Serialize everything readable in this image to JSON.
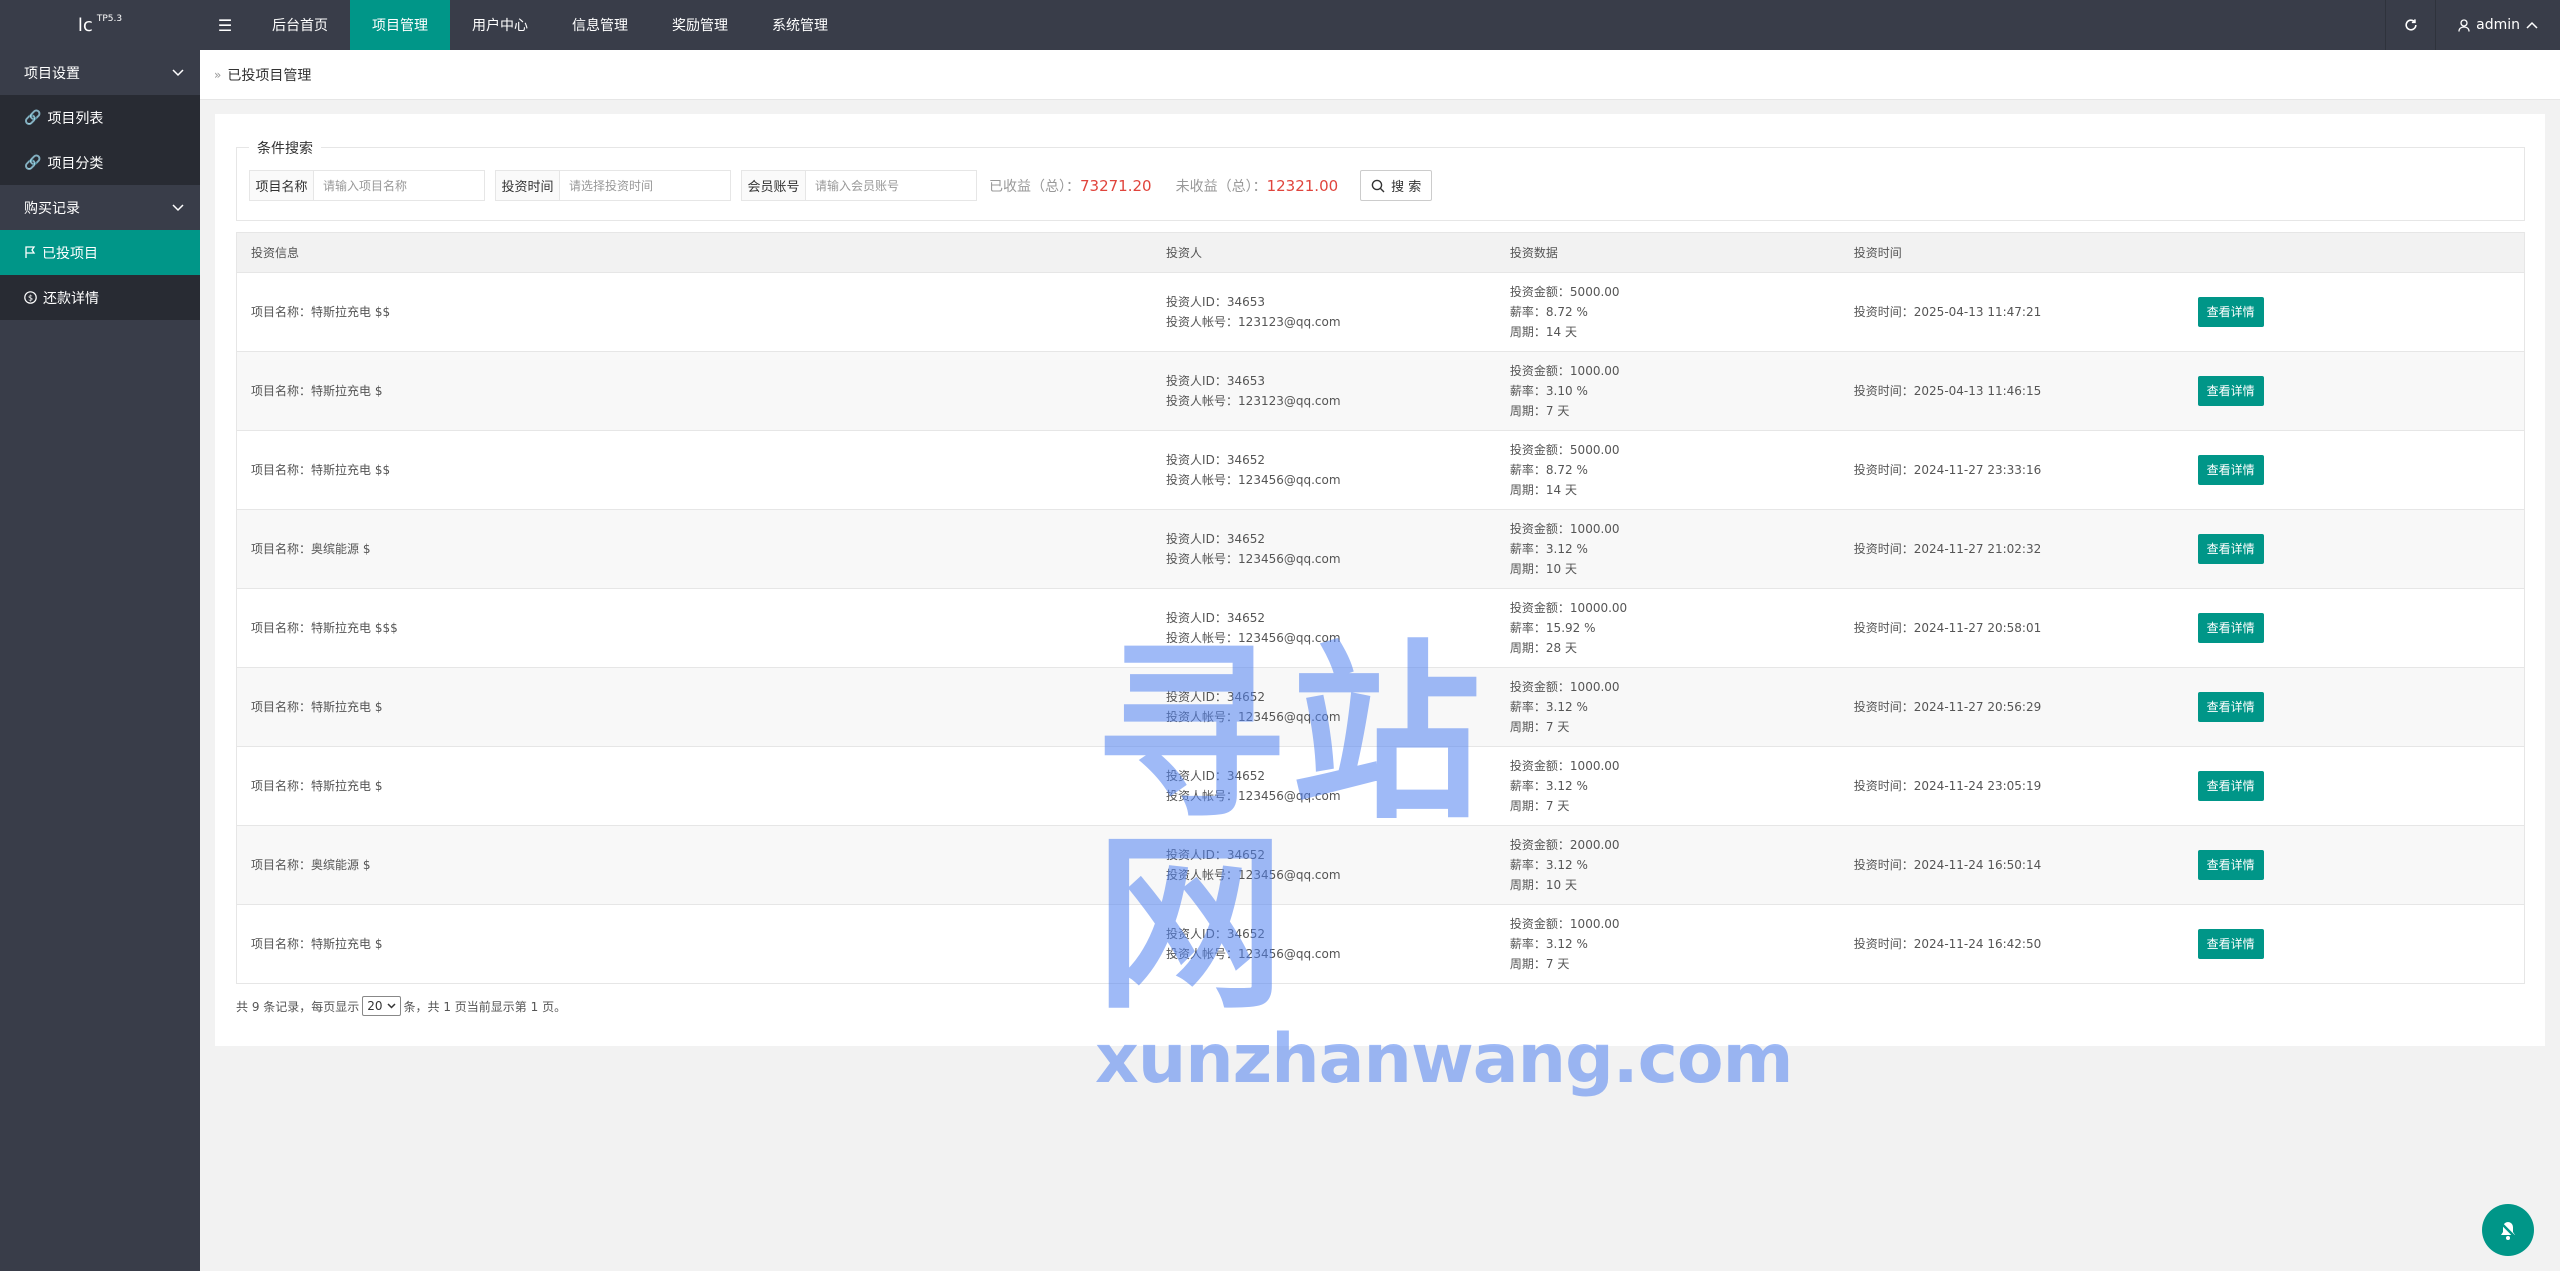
{
  "brand": {
    "logo": "lc",
    "version": "TP5.3"
  },
  "topnav": {
    "tabs": [
      "后台首页",
      "项目管理",
      "用户中心",
      "信息管理",
      "奖励管理",
      "系统管理"
    ],
    "active": 1,
    "user": "admin"
  },
  "sidebar": {
    "groups": [
      {
        "label": "项目设置",
        "items": [
          "项目列表",
          "项目分类"
        ]
      },
      {
        "label": "购买记录",
        "items": [
          "已投项目",
          "还款详情"
        ]
      }
    ],
    "active_item": "已投项目"
  },
  "breadcrumb": "已投项目管理",
  "search": {
    "legend": "条件搜索",
    "name_label": "项目名称",
    "name_placeholder": "请输入项目名称",
    "time_label": "投资时间",
    "time_placeholder": "请选择投资时间",
    "account_label": "会员账号",
    "account_placeholder": "请输入会员账号",
    "earned_label": "已收益（总）：",
    "earned_value": "73271.20",
    "unearned_label": "未收益（总）：",
    "unearned_value": "12321.00",
    "button": "搜 索"
  },
  "table": {
    "headers": [
      "投资信息",
      "投资人",
      "投资数据",
      "投资时间",
      ""
    ],
    "detail_button": "查看详情",
    "rows": [
      {
        "project": "项目名称：特斯拉充电 $$",
        "investor_id": "投资人ID：34653",
        "investor_acct": "投资人帐号：123123@qq.com",
        "amount": "投资金额：5000.00",
        "rate": "薪率：8.72 %",
        "period": "周期：14 天",
        "time": "投资时间：2025-04-13 11:47:21"
      },
      {
        "project": "项目名称：特斯拉充电 $",
        "investor_id": "投资人ID：34653",
        "investor_acct": "投资人帐号：123123@qq.com",
        "amount": "投资金额：1000.00",
        "rate": "薪率：3.10 %",
        "period": "周期：7 天",
        "time": "投资时间：2025-04-13 11:46:15"
      },
      {
        "project": "项目名称：特斯拉充电 $$",
        "investor_id": "投资人ID：34652",
        "investor_acct": "投资人帐号：123456@qq.com",
        "amount": "投资金额：5000.00",
        "rate": "薪率：8.72 %",
        "period": "周期：14 天",
        "time": "投资时间：2024-11-27 23:33:16"
      },
      {
        "project": "项目名称：奥缤能源 $",
        "investor_id": "投资人ID：34652",
        "investor_acct": "投资人帐号：123456@qq.com",
        "amount": "投资金额：1000.00",
        "rate": "薪率：3.12 %",
        "period": "周期：10 天",
        "time": "投资时间：2024-11-27 21:02:32"
      },
      {
        "project": "项目名称：特斯拉充电 $$$",
        "investor_id": "投资人ID：34652",
        "investor_acct": "投资人帐号：123456@qq.com",
        "amount": "投资金额：10000.00",
        "rate": "薪率：15.92 %",
        "period": "周期：28 天",
        "time": "投资时间：2024-11-27 20:58:01"
      },
      {
        "project": "项目名称：特斯拉充电 $",
        "investor_id": "投资人ID：34652",
        "investor_acct": "投资人帐号：123456@qq.com",
        "amount": "投资金额：1000.00",
        "rate": "薪率：3.12 %",
        "period": "周期：7 天",
        "time": "投资时间：2024-11-27 20:56:29"
      },
      {
        "project": "项目名称：特斯拉充电 $",
        "investor_id": "投资人ID：34652",
        "investor_acct": "投资人帐号：123456@qq.com",
        "amount": "投资金额：1000.00",
        "rate": "薪率：3.12 %",
        "period": "周期：7 天",
        "time": "投资时间：2024-11-24 23:05:19"
      },
      {
        "project": "项目名称：奥缤能源 $",
        "investor_id": "投资人ID：34652",
        "investor_acct": "投资人帐号：123456@qq.com",
        "amount": "投资金额：2000.00",
        "rate": "薪率：3.12 %",
        "period": "周期：10 天",
        "time": "投资时间：2024-11-24 16:50:14"
      },
      {
        "project": "项目名称：特斯拉充电 $",
        "investor_id": "投资人ID：34652",
        "investor_acct": "投资人帐号：123456@qq.com",
        "amount": "投资金额：1000.00",
        "rate": "薪率：3.12 %",
        "period": "周期：7 天",
        "time": "投资时间：2024-11-24 16:42:50"
      }
    ]
  },
  "pager": {
    "prefix": "共 9 条记录，每页显示",
    "per_page": "20",
    "suffix": "条，共 1 页当前显示第 1 页。"
  },
  "watermark": {
    "cn": "寻站网",
    "en": "xunzhanwang.com"
  },
  "colors": {
    "accent": "#009688",
    "dark": "#393d49",
    "highlight": "#e0443c"
  }
}
